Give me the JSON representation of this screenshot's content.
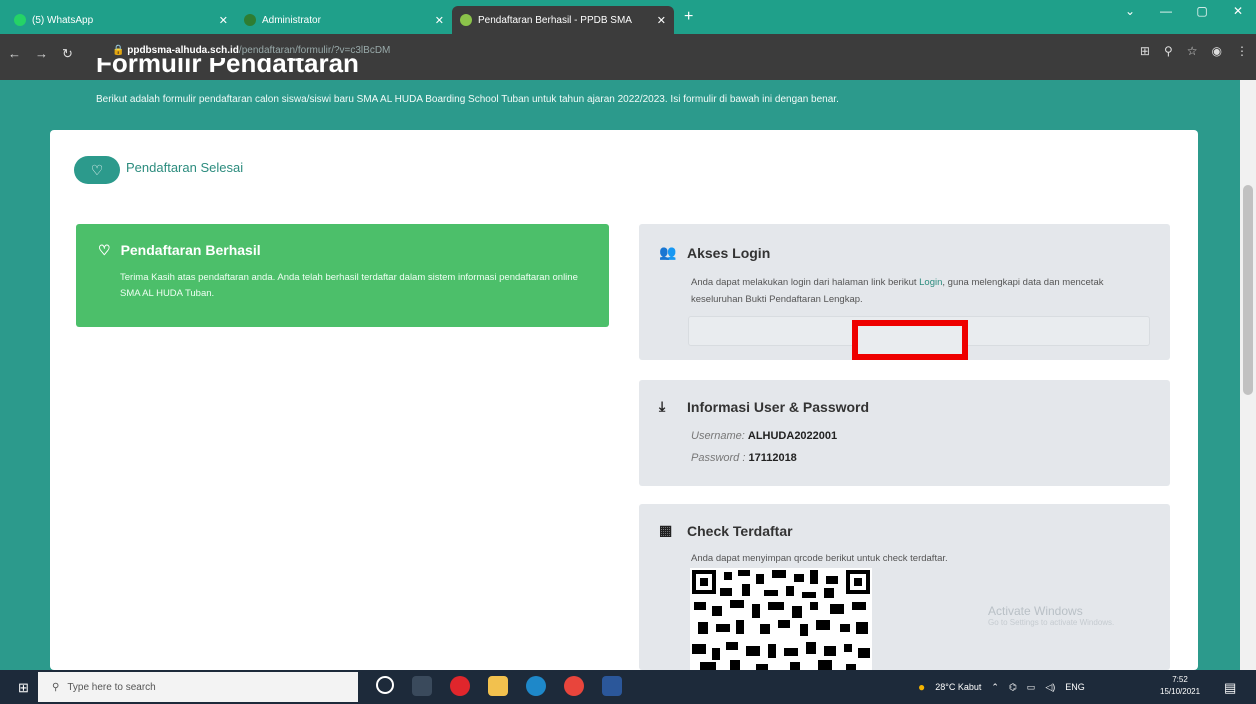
{
  "browser": {
    "tabs": [
      {
        "label": "(5) WhatsApp",
        "color": "#25d366"
      },
      {
        "label": "Administrator",
        "color": "#4caf50"
      },
      {
        "label": "Pendaftaran Berhasil - PPDB SMA",
        "color": "#66bb6a"
      }
    ],
    "new_tab_symbol": "+",
    "url_domain": "ppdbsma-alhuda.sch.id",
    "url_path": "/pendaftaran/formulir/?v=c3lBcDM"
  },
  "page": {
    "title": "Formulir Pendaftaran",
    "subtitle": "Berikut adalah formulir pendaftaran calon siswa/siswi baru SMA AL HUDA Boarding School Tuban untuk tahun ajaran 2022/2023. Isi formulir di bawah ini dengan benar.",
    "step_label": "Pendaftaran Selesai"
  },
  "success": {
    "title": "Pendaftaran Berhasil",
    "body": "Terima Kasih atas pendaftaran anda. Anda telah berhasil terdaftar dalam sistem informasi pendaftaran online SMA AL HUDA Tuban."
  },
  "login": {
    "title": "Akses Login",
    "text_before": "Anda dapat melakukan login dari halaman link berikut ",
    "link": "Login",
    "text_after": ", guna melengkapi data dan mencetak keseluruhan Bukti Pendaftaran Lengkap."
  },
  "info": {
    "title": "Informasi User & Password",
    "username_label": "Username",
    "username": "ALHUDA2022001",
    "password_label": "Password",
    "password": "17112018"
  },
  "check": {
    "title": "Check Terdaftar",
    "text": "Anda dapat menyimpan qrcode berikut untuk check terdaftar."
  },
  "watermark": {
    "title": "Activate Windows",
    "sub": "Go to Settings to activate Windows."
  },
  "taskbar": {
    "search_placeholder": "Type here to search",
    "weather": "28°C  Kabut",
    "lang": "ENG",
    "time": "7:52",
    "date": "15/10/2021"
  },
  "colors": {
    "brand": "#2c9a8c",
    "success": "#4cbf6a",
    "highlight": "#e00000"
  }
}
